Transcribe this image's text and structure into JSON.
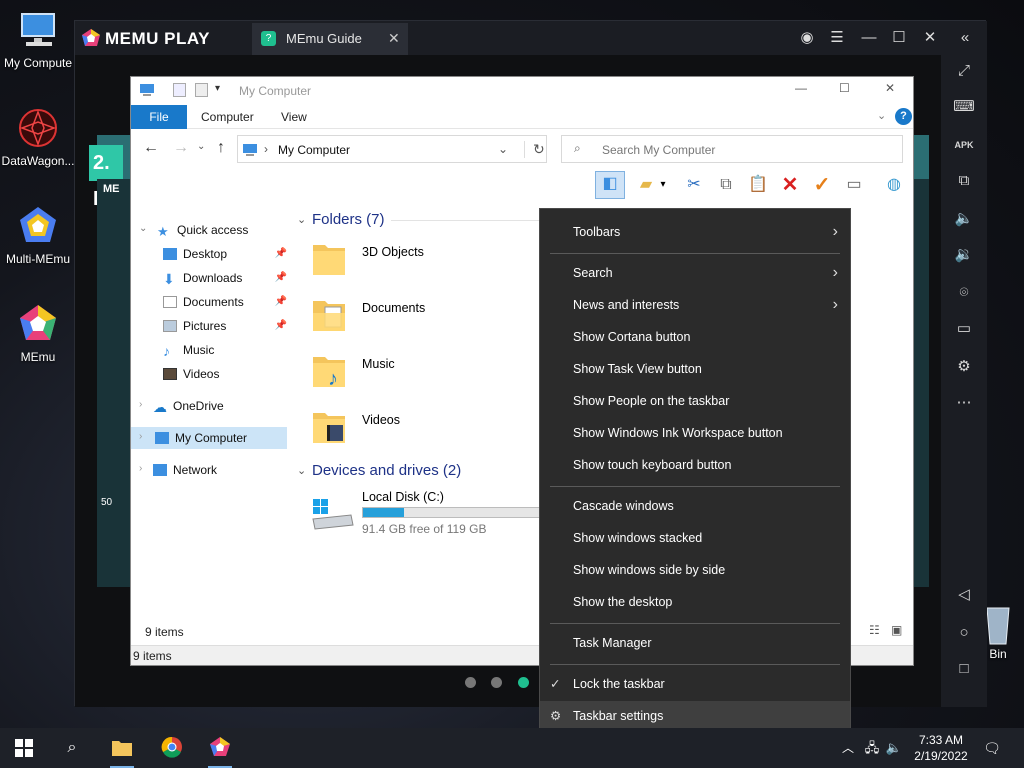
{
  "desktop_icons": [
    {
      "label": "My Compute"
    },
    {
      "label": "DataWagon..."
    },
    {
      "label": "Multi-MEmu"
    },
    {
      "label": "MEmu"
    }
  ],
  "recycle_bin_label": "Bin",
  "memu": {
    "logo": "MEMU PLAY",
    "tab_label": "MEmu Guide",
    "game_banner": "2. K",
    "game_label_top": "ME",
    "game_number": "50"
  },
  "explorer": {
    "title": "My Computer",
    "ribbon_tabs": [
      "File",
      "Computer",
      "View"
    ],
    "address_path": "My Computer",
    "search_placeholder": "Search My Computer",
    "nav": {
      "quick_access": "Quick access",
      "desktop": "Desktop",
      "downloads": "Downloads",
      "documents": "Documents",
      "pictures": "Pictures",
      "music": "Music",
      "videos": "Videos",
      "onedrive": "OneDrive",
      "my_computer": "My Computer",
      "network": "Network"
    },
    "folders_header": "Folders (7)",
    "folders": [
      "3D Objects",
      "Documents",
      "Music",
      "Videos"
    ],
    "devices_header": "Devices and drives (2)",
    "drive": {
      "name": "Local Disk (C:)",
      "free_text": "91.4 GB free of 119 GB",
      "used_fraction": 0.232
    },
    "status_items": "9 items",
    "status_items_bottom": "9 items"
  },
  "context_menu": {
    "toolbars": "Toolbars",
    "search": "Search",
    "news": "News and interests",
    "cortana": "Show Cortana button",
    "taskview": "Show Task View button",
    "people": "Show People on the taskbar",
    "ink": "Show Windows Ink Workspace button",
    "touchkb": "Show touch keyboard button",
    "cascade": "Cascade windows",
    "stacked": "Show windows stacked",
    "sidebyside": "Show windows side by side",
    "desktop": "Show the desktop",
    "taskmgr": "Task Manager",
    "lock": "Lock the taskbar",
    "settings": "Taskbar settings"
  },
  "taskbar": {
    "time": "7:33 AM",
    "date": "2/19/2022"
  },
  "colors": {
    "accent": "#1979ca",
    "memu_dark": "#1b1d23",
    "menu_bg": "#2b2b2b"
  }
}
